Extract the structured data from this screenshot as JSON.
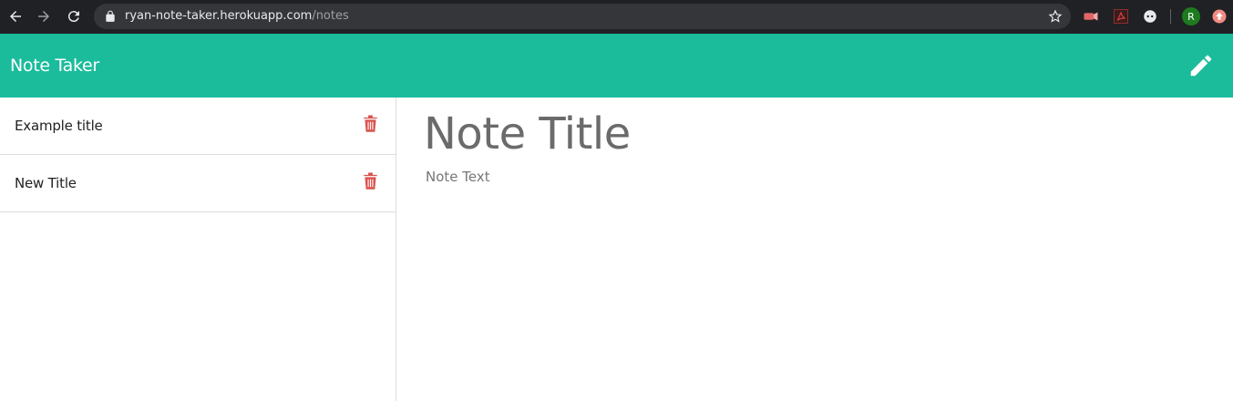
{
  "browser": {
    "url_host": "ryan-note-taker.herokuapp.com",
    "url_path": "/notes",
    "profile_initial": "R",
    "icons": [
      "back-icon",
      "forward-icon",
      "reload-icon",
      "lock-icon",
      "star-icon",
      "extension-icon",
      "pdf-extension-icon",
      "extension-icon",
      "profile-avatar",
      "extension-icon"
    ]
  },
  "header": {
    "brand": "Note Taker",
    "new_note_icon": "pencil-icon",
    "color": "#1abc9c"
  },
  "notes": [
    {
      "title": "Example title"
    },
    {
      "title": "New Title"
    }
  ],
  "editor": {
    "title_placeholder": "Note Title",
    "text_placeholder": "Note Text"
  },
  "colors": {
    "accent": "#1abc9c",
    "delete": "#d9534f"
  }
}
